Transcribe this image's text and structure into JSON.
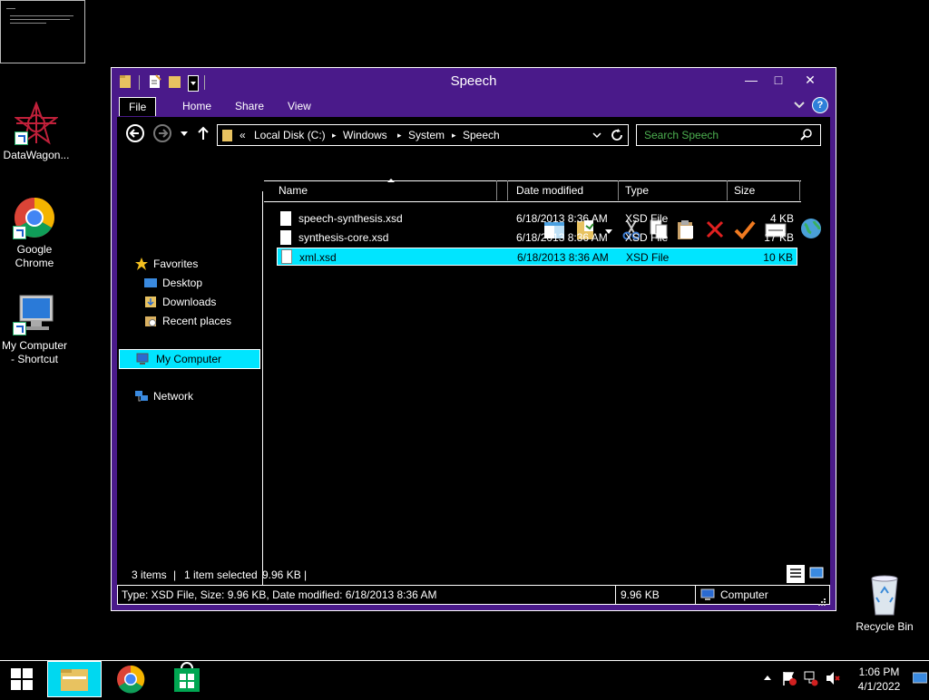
{
  "desktop": {
    "icons": [
      {
        "label": "DataWagon...",
        "icon": "datawagon-icon"
      },
      {
        "label": "Google\nChrome",
        "icon": "chrome-icon"
      },
      {
        "label": "My Computer\n- Shortcut",
        "icon": "computer-icon"
      },
      {
        "label": "Recycle Bin",
        "icon": "recycle-bin-icon"
      }
    ]
  },
  "window": {
    "title": "Speech",
    "controls": {
      "minimize": "—",
      "maximize": "□",
      "close": "✕"
    },
    "ribbon": {
      "tabs": [
        "File",
        "Home",
        "Share",
        "View"
      ],
      "help": "?"
    },
    "address": {
      "prefix": "«",
      "crumbs": [
        "Local Disk (C:)",
        "Windows",
        "System",
        "Speech"
      ],
      "separator": "▸"
    },
    "search": {
      "placeholder": "Search Speech"
    },
    "nav": {
      "favorites": "Favorites",
      "favorite_items": [
        "Desktop",
        "Downloads",
        "Recent places"
      ],
      "my_computer": "My Computer",
      "network": "Network"
    },
    "columns": {
      "name": "Name",
      "date": "Date modified",
      "type": "Type",
      "size": "Size"
    },
    "files": [
      {
        "name": "speech-synthesis.xsd",
        "date": "6/18/2013 8:36 AM",
        "type": "XSD File",
        "size": "4 KB",
        "selected": false
      },
      {
        "name": "synthesis-core.xsd",
        "date": "6/18/2013 8:36 AM",
        "type": "XSD File",
        "size": "17 KB",
        "selected": false
      },
      {
        "name": "xml.xsd",
        "date": "6/18/2013 8:36 AM",
        "type": "XSD File",
        "size": "10 KB",
        "selected": true
      }
    ],
    "status": {
      "items": "3 items",
      "selected": "1 item selected",
      "selected_size": "9.96 KB"
    },
    "details_bar": {
      "text": "Type: XSD File, Size: 9.96 KB, Date modified: 6/18/2013 8:36 AM",
      "size": "9.96 KB",
      "location": "Computer"
    }
  },
  "taskbar": {
    "time": "1:06 PM",
    "date": "4/1/2022"
  },
  "colors": {
    "window_frame": "#4a1a8a",
    "selection": "#00e5ff",
    "background": "#000000"
  }
}
